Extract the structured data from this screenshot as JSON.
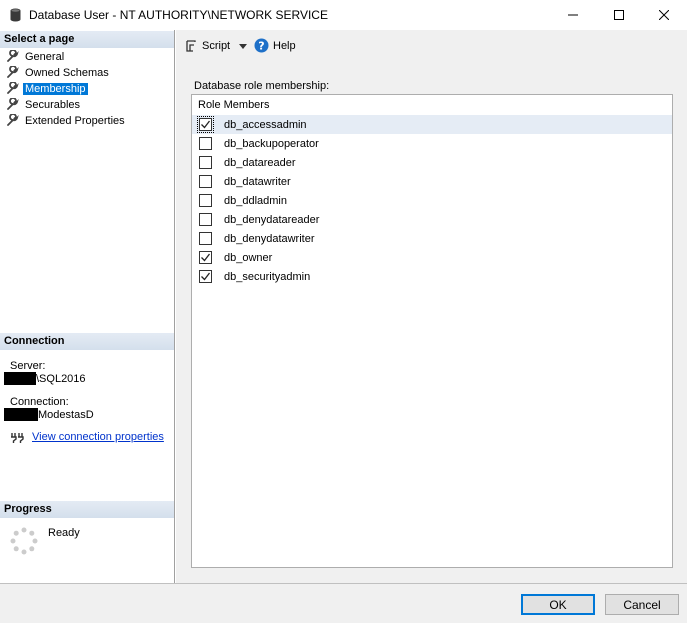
{
  "window": {
    "title": "Database User - NT AUTHORITY\\NETWORK SERVICE",
    "icon": "database-icon"
  },
  "left": {
    "select_page_header": "Select a page",
    "pages": [
      {
        "label": "General",
        "selected": false
      },
      {
        "label": "Owned Schemas",
        "selected": false
      },
      {
        "label": "Membership",
        "selected": true
      },
      {
        "label": "Securables",
        "selected": false
      },
      {
        "label": "Extended Properties",
        "selected": false
      }
    ],
    "connection_header": "Connection",
    "server_label": "Server:",
    "server_value": "\\SQL2016",
    "connection_label": "Connection:",
    "connection_value": "ModestasD",
    "view_connection_link": "View connection properties",
    "progress_header": "Progress",
    "progress_status": "Ready"
  },
  "toolbar": {
    "script_label": "Script",
    "help_label": "Help"
  },
  "membership": {
    "field_label": "Database role membership:",
    "column_headers": [
      "Role",
      "Members"
    ],
    "roles": [
      {
        "name": "db_accessadmin",
        "checked": true
      },
      {
        "name": "db_backupoperator",
        "checked": false
      },
      {
        "name": "db_datareader",
        "checked": false
      },
      {
        "name": "db_datawriter",
        "checked": false
      },
      {
        "name": "db_ddladmin",
        "checked": false
      },
      {
        "name": "db_denydatareader",
        "checked": false
      },
      {
        "name": "db_denydatawriter",
        "checked": false
      },
      {
        "name": "db_owner",
        "checked": true
      },
      {
        "name": "db_securityadmin",
        "checked": true
      }
    ]
  },
  "footer": {
    "ok_label": "OK",
    "cancel_label": "Cancel"
  },
  "colors": {
    "selection": "#0078d7",
    "link": "#0033cc",
    "header_bg": "#dde6f0"
  }
}
